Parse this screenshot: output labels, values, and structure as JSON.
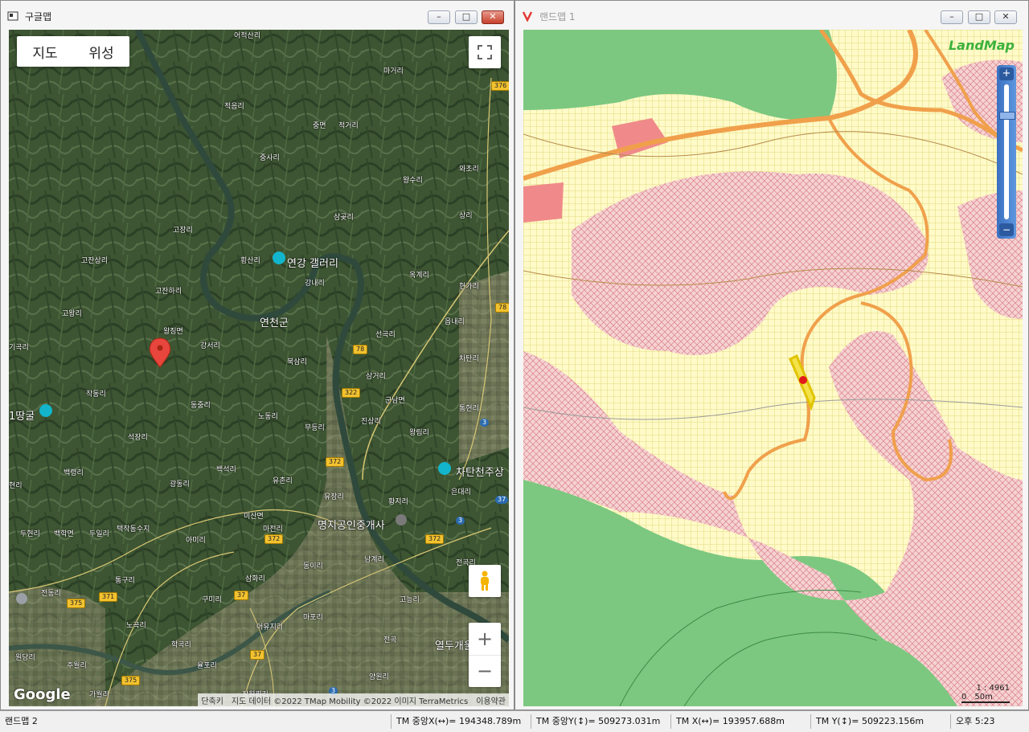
{
  "left_window": {
    "title": "구글맵",
    "tabs": [
      "지도",
      "위성"
    ],
    "google_logo": "Google",
    "attribution": [
      "단축키",
      "지도 데이터 ©2022 TMap Mobility ©2022 이미지 TerraMetrics",
      "이용약관"
    ],
    "zoom_in": "+",
    "zoom_out": "−",
    "labels": [
      "어적산리",
      "마거리",
      "적음리",
      "중면",
      "적거리",
      "중사리",
      "왕수리",
      "와초리",
      "삼곶리",
      "상리",
      "고장리",
      "고잔상리",
      "횡산리",
      "연강 갤러리",
      "강내리",
      "옥계리",
      "현가리",
      "고잔하리",
      "고왕리",
      "연천군",
      "읍내리",
      "왕징면",
      "기곡리",
      "강서리",
      "선곡리",
      "북삼리",
      "차탄리",
      "삼거리",
      "작동리",
      "군남면",
      "통현리",
      "1땅굴",
      "동중리",
      "노동리",
      "무등리",
      "진상리",
      "왕림리",
      "석장리",
      "백석리",
      "유촌리",
      "차탄천주상",
      "현리",
      "백령리",
      "광동리",
      "유장리",
      "황지리",
      "은대리",
      "미산면",
      "명지공인중개사",
      "두현리",
      "백학면",
      "두일리",
      "택작동수지",
      "아미리",
      "마전리",
      "동이리",
      "남계리",
      "전곡리",
      "통구리",
      "삼화리",
      "전동리",
      "구미리",
      "고능리",
      "노곡리",
      "어유지리",
      "마포리",
      "전곡",
      "열두개울",
      "학곡리",
      "율포리",
      "원당리",
      "주월리",
      "양원리",
      "작은리",
      "가월리",
      "장원리"
    ],
    "road_numbers": [
      "376",
      "78",
      "78",
      "322",
      "372",
      "372",
      "372",
      "371",
      "375",
      "37",
      "37",
      "375",
      "3",
      "3",
      "3",
      "37"
    ]
  },
  "right_window": {
    "title": "랜드맵 1",
    "logo": "LandMap",
    "scale_ratio": "1 : 4961",
    "scale_labels": [
      "0",
      "50m"
    ]
  },
  "statusbar": {
    "app": "랜드맵 2",
    "tm_center_x": "TM 중앙X(↔)= 194348.789m",
    "tm_center_y": "TM 중앙Y(↕)= 509273.031m",
    "tm_x": "TM X(↔)= 193957.688m",
    "tm_y": "TM Y(↕)= 509223.156m",
    "clock": "오후 5:23"
  }
}
